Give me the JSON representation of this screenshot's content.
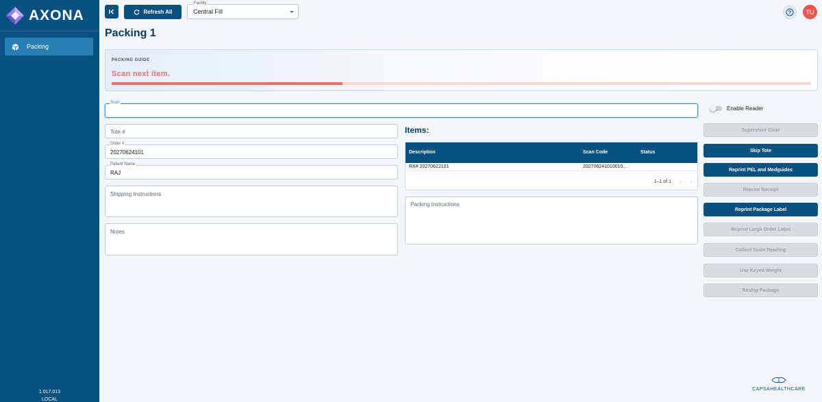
{
  "app": {
    "name": "AXONA",
    "version": "1.017.013",
    "environment": "LOCAL"
  },
  "sidebar": {
    "items": [
      {
        "label": "Packing",
        "icon": "package-icon",
        "active": true
      }
    ]
  },
  "toolbar": {
    "refresh_label": "Refresh All",
    "facility": {
      "label": "Facility",
      "value": "Central Fill"
    },
    "avatar_initials": "TU"
  },
  "page": {
    "title": "Packing 1"
  },
  "guide": {
    "caption": "PACKING GUIDE",
    "message": "Scan next item.",
    "progress": 0.33
  },
  "form": {
    "scan": {
      "label": "Scan",
      "value": ""
    },
    "tote": {
      "placeholder": "Tote #"
    },
    "order": {
      "label": "Order #",
      "value": "20270624101"
    },
    "patient": {
      "label": "Patient Name",
      "value": "RAJ"
    },
    "shipping": {
      "placeholder": "Shipping Instructions"
    },
    "notes": {
      "placeholder": "Notes"
    },
    "packing": {
      "placeholder": "Packing Instructions"
    }
  },
  "reader": {
    "label": "Enable Reader",
    "enabled": false
  },
  "items": {
    "title": "Items:",
    "columns": [
      "Description",
      "Scan Code",
      "Status"
    ],
    "rows": [
      {
        "description": "RX# 20270622101",
        "scan_code": "202706241010010...",
        "status": ""
      }
    ],
    "pagination": "1–1 of 1"
  },
  "actions": [
    {
      "label": "Supervisor Clear",
      "enabled": false
    },
    {
      "label": "Skip Tote",
      "enabled": true
    },
    {
      "label": "Reprint PEL and Medguides",
      "enabled": true
    },
    {
      "label": "Reprint Receipt",
      "enabled": false
    },
    {
      "label": "Reprint Package Label",
      "enabled": true
    },
    {
      "label": "Reprint Large Order Label",
      "enabled": false
    },
    {
      "label": "Collect Scale Reading",
      "enabled": false
    },
    {
      "label": "Use Keyed Weight",
      "enabled": false
    },
    {
      "label": "Reship Package",
      "enabled": false
    }
  ],
  "footer": {
    "brand": "CAPSAHEALTHCARE"
  },
  "colors": {
    "primary": "#0a5080",
    "accent": "#e8716a",
    "avatar": "#e8574d",
    "disabled": "#d8dce1"
  }
}
